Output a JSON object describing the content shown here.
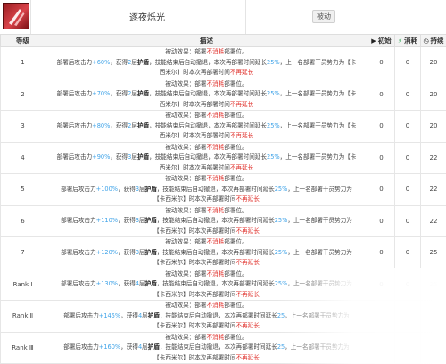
{
  "skill": {
    "name": "逐夜烁光",
    "type_badge": "被动",
    "icon": "skill-icon"
  },
  "table": {
    "headers": {
      "level": "等级",
      "desc": "描述",
      "init": "初始",
      "cost": "消耗",
      "duration": "持续"
    },
    "header_icons": {
      "init": "play-icon",
      "cost": "lightning-icon",
      "duration": "clock-icon"
    },
    "text": {
      "passive": "被动效果：部署",
      "not_cost": "不消耗",
      "deploy_slot": "部署位。",
      "atk_after": "部署后攻击力",
      "gain": "，获得",
      "shield_layers": "层",
      "shield": "护盾",
      "retreat": "，技能结束后自动撤退，本次再部署时间延长",
      "leader": "，上一名部署干员势力为【卡西米尔】时本次再部署时间",
      "leader_a": "，上一名部署干员势力为【卡",
      "leader_b": "西米尔】时本次再部署时间",
      "leader_c": "，上一名部署干员势力为",
      "leader_d": "【卡西米尔】时本次再部署时间",
      "not_extend": "不再延长"
    },
    "rows": [
      {
        "level": "1",
        "atk": "+60%",
        "layers": "2",
        "ext": "25%",
        "init": "0",
        "cost": "0",
        "duration": "20"
      },
      {
        "level": "2",
        "atk": "+70%",
        "layers": "2",
        "ext": "25%",
        "init": "0",
        "cost": "0",
        "duration": "20"
      },
      {
        "level": "3",
        "atk": "+80%",
        "layers": "2",
        "ext": "25%",
        "init": "0",
        "cost": "0",
        "duration": "20"
      },
      {
        "level": "4",
        "atk": "+90%",
        "layers": "3",
        "ext": "25%",
        "init": "0",
        "cost": "0",
        "duration": "22"
      },
      {
        "level": "5",
        "atk": "+100%",
        "layers": "3",
        "ext": "25%",
        "init": "0",
        "cost": "0",
        "duration": "22"
      },
      {
        "level": "6",
        "atk": "+110%",
        "layers": "3",
        "ext": "25%",
        "init": "0",
        "cost": "0",
        "duration": "22"
      },
      {
        "level": "7",
        "atk": "+120%",
        "layers": "3",
        "ext": "25%",
        "init": "0",
        "cost": "0",
        "duration": "25"
      },
      {
        "level": "Rank Ⅰ",
        "atk": "+130%",
        "layers": "4",
        "ext": "25%",
        "init": "0",
        "cost": "0",
        "duration": "25"
      },
      {
        "level": "Rank Ⅱ",
        "atk": "+145%",
        "layers": "4",
        "ext": "25",
        "init": "",
        "cost": "",
        "duration": ""
      },
      {
        "level": "Rank Ⅲ",
        "atk": "+160%",
        "layers": "4",
        "ext": "25",
        "init": "",
        "cost": "",
        "duration": ""
      }
    ]
  }
}
